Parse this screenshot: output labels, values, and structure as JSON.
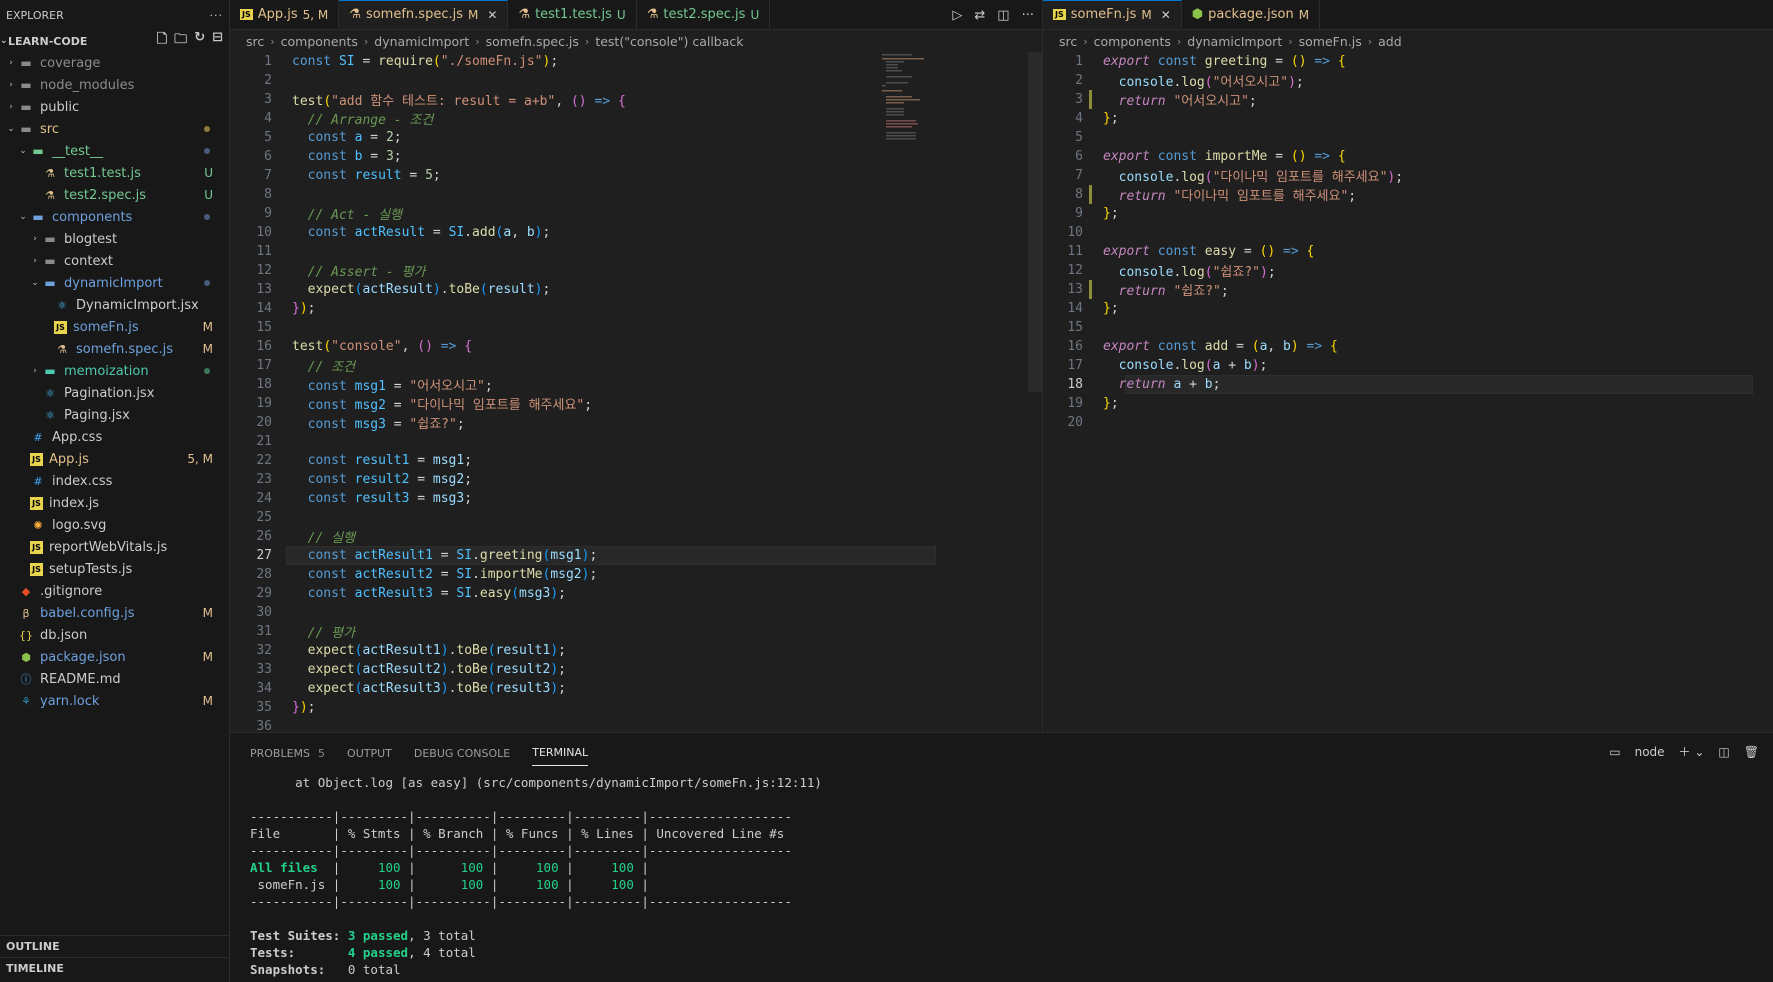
{
  "explorer": {
    "title": "EXPLORER",
    "more": "···",
    "project": "LEARN-CODE",
    "outline": "OUTLINE",
    "timeline": "TIMELINE",
    "items": [
      {
        "label": "coverage",
        "color": "grey",
        "chev": "›",
        "icon": "folder",
        "badge": ""
      },
      {
        "label": "node_modules",
        "color": "grey",
        "chev": "›",
        "icon": "folder",
        "badge": ""
      },
      {
        "label": "public",
        "color": "white",
        "chev": "›",
        "icon": "folder",
        "badge": ""
      },
      {
        "label": "src",
        "color": "yellow",
        "chev": "⌄",
        "icon": "folder",
        "badge": ""
      },
      {
        "label": "__test__",
        "color": "green",
        "chev": "⌄",
        "icon": "folder",
        "badge": ""
      },
      {
        "label": "test1.test.js",
        "color": "green",
        "chev": "",
        "icon": "flask",
        "badge": "U"
      },
      {
        "label": "test2.spec.js",
        "color": "green",
        "chev": "",
        "icon": "flask",
        "badge": "U"
      },
      {
        "label": "components",
        "color": "blue",
        "chev": "⌄",
        "icon": "folder",
        "badge": ""
      },
      {
        "label": "blogtest",
        "color": "white",
        "chev": "›",
        "icon": "folder",
        "badge": ""
      },
      {
        "label": "context",
        "color": "white",
        "chev": "›",
        "icon": "folder",
        "badge": ""
      },
      {
        "label": "dynamicImport",
        "color": "blue",
        "chev": "⌄",
        "icon": "folder",
        "badge": ""
      },
      {
        "label": "DynamicImport.jsx",
        "color": "white",
        "chev": "",
        "icon": "react",
        "badge": ""
      },
      {
        "label": "someFn.js",
        "color": "blue",
        "chev": "",
        "icon": "js",
        "badge": "M"
      },
      {
        "label": "somefn.spec.js",
        "color": "blue",
        "chev": "",
        "icon": "flask",
        "badge": "M"
      },
      {
        "label": "memoization",
        "color": "teal",
        "chev": "›",
        "icon": "folder",
        "badge": ""
      },
      {
        "label": "Pagination.jsx",
        "color": "white",
        "chev": "",
        "icon": "react",
        "badge": ""
      },
      {
        "label": "Paging.jsx",
        "color": "white",
        "chev": "",
        "icon": "react",
        "badge": ""
      },
      {
        "label": "App.css",
        "color": "white",
        "chev": "",
        "icon": "css",
        "badge": ""
      },
      {
        "label": "App.js",
        "color": "yellow",
        "chev": "",
        "icon": "js",
        "badge": "5, M"
      },
      {
        "label": "index.css",
        "color": "white",
        "chev": "",
        "icon": "css",
        "badge": ""
      },
      {
        "label": "index.js",
        "color": "white",
        "chev": "",
        "icon": "js",
        "badge": ""
      },
      {
        "label": "logo.svg",
        "color": "white",
        "chev": "",
        "icon": "svg",
        "badge": ""
      },
      {
        "label": "reportWebVitals.js",
        "color": "white",
        "chev": "",
        "icon": "js",
        "badge": ""
      },
      {
        "label": "setupTests.js",
        "color": "white",
        "chev": "",
        "icon": "js",
        "badge": ""
      },
      {
        "label": ".gitignore",
        "color": "white",
        "chev": "",
        "icon": "git",
        "badge": ""
      },
      {
        "label": "babel.config.js",
        "color": "blue",
        "chev": "",
        "icon": "babel",
        "badge": "M"
      },
      {
        "label": "db.json",
        "color": "white",
        "chev": "",
        "icon": "json",
        "badge": ""
      },
      {
        "label": "package.json",
        "color": "blue",
        "chev": "",
        "icon": "npm",
        "badge": "M"
      },
      {
        "label": "README.md",
        "color": "white",
        "chev": "",
        "icon": "info",
        "badge": ""
      },
      {
        "label": "yarn.lock",
        "color": "blue",
        "chev": "",
        "icon": "yarn",
        "badge": "M"
      }
    ]
  },
  "editorA": {
    "tabs": [
      {
        "label": "App.js",
        "mod": "5, M",
        "icon": "js",
        "active": false
      },
      {
        "label": "somefn.spec.js",
        "mod": "M",
        "icon": "flask",
        "active": true
      },
      {
        "label": "test1.test.js",
        "mod": "U",
        "icon": "flask",
        "active": false
      },
      {
        "label": "test2.spec.js",
        "mod": "U",
        "icon": "flask",
        "active": false
      }
    ],
    "breadcrumb": [
      "src",
      "components",
      "dynamicImport",
      "somefn.spec.js",
      "test(\"console\") callback"
    ],
    "current_line": 27
  },
  "editorB": {
    "tabs": [
      {
        "label": "someFn.js",
        "mod": "M",
        "icon": "js",
        "active": true
      },
      {
        "label": "package.json",
        "mod": "M",
        "icon": "npm",
        "active": false
      }
    ],
    "breadcrumb": [
      "src",
      "components",
      "dynamicImport",
      "someFn.js",
      "add"
    ],
    "current_line": 18
  },
  "panel": {
    "tabs": [
      "PROBLEMS",
      "OUTPUT",
      "DEBUG CONSOLE",
      "TERMINAL"
    ],
    "problems_count": "5",
    "shell": "node",
    "terminal": [
      "      at Object.log [as easy] (src/components/dynamicImport/someFn.js:12:11)",
      "",
      "-----------|---------|----------|---------|---------|-------------------",
      "File       | % Stmts | % Branch | % Funcs | % Lines | Uncovered Line #s ",
      "-----------|---------|----------|---------|---------|-------------------",
      "All files  |     100 |      100 |     100 |     100 |                   ",
      " someFn.js |     100 |      100 |     100 |     100 |                   ",
      "-----------|---------|----------|---------|---------|-------------------",
      "",
      "Test Suites: 3 passed, 3 total",
      "Tests:       4 passed, 4 total",
      "Snapshots:   0 total"
    ]
  }
}
